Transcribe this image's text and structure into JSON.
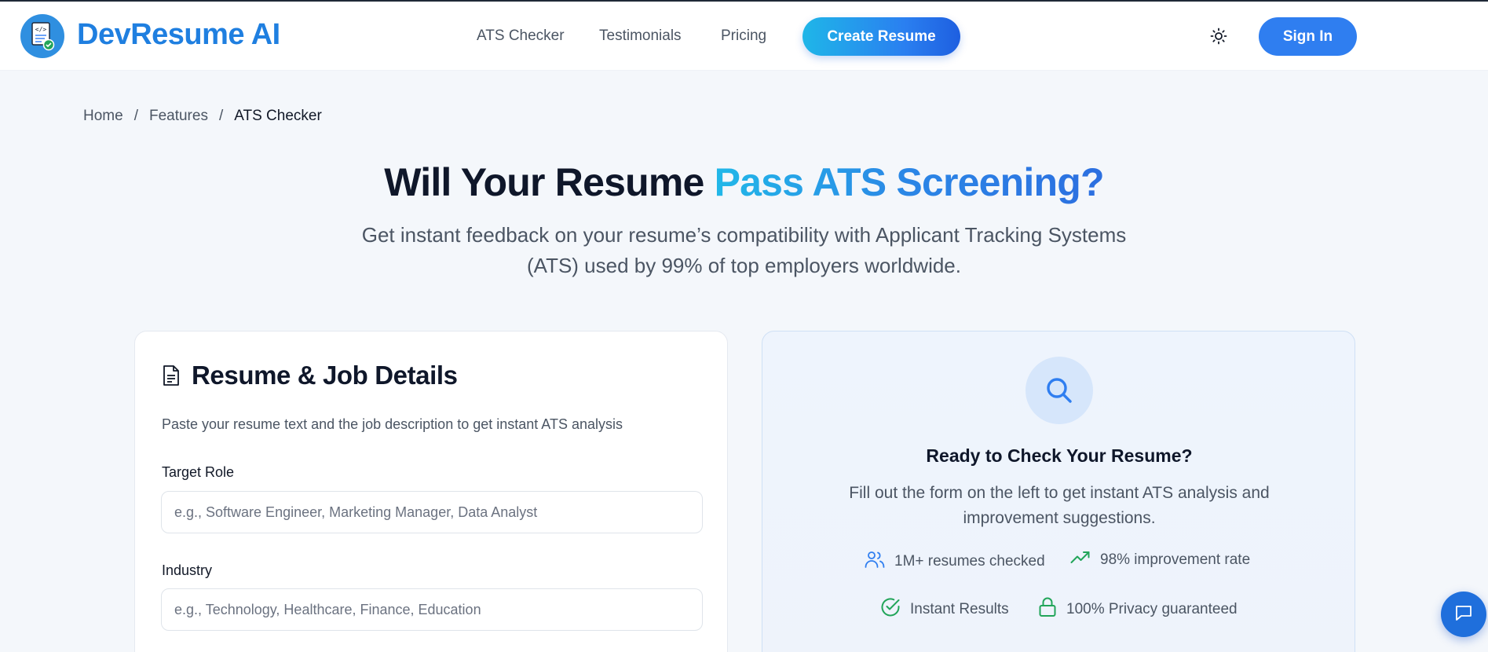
{
  "brand": {
    "name": "DevResume AI",
    "logo_icon": "resume-check-icon"
  },
  "nav": {
    "links": [
      "ATS Checker",
      "Testimonials",
      "Pricing"
    ],
    "create_label": "Create Resume",
    "theme_icon": "sun-icon",
    "signin_label": "Sign In"
  },
  "breadcrumb": {
    "items": [
      "Home",
      "Features",
      "ATS Checker"
    ],
    "separator": "/"
  },
  "hero": {
    "title_plain": "Will Your Resume",
    "title_accent": "Pass ATS Screening?",
    "subtitle": "Get instant feedback on your resume’s compatibility with Applicant Tracking Systems (ATS) used by 99% of top employers worldwide."
  },
  "form_card": {
    "icon": "document-icon",
    "title": "Resume & Job Details",
    "description": "Paste your resume text and the job description to get instant ATS analysis",
    "fields": [
      {
        "label": "Target Role",
        "value": "",
        "placeholder": "e.g., Software Engineer, Marketing Manager, Data Analyst"
      },
      {
        "label": "Industry",
        "value": "",
        "placeholder": "e.g., Technology, Healthcare, Finance, Education"
      }
    ]
  },
  "result_card": {
    "icon": "search-icon",
    "title": "Ready to Check Your Resume?",
    "description": "Fill out the form on the left to get instant ATS analysis and improvement suggestions.",
    "stats": [
      {
        "icon": "users-icon",
        "text": "1M+ resumes checked"
      },
      {
        "icon": "trending-up-icon",
        "text": "98% improvement rate"
      },
      {
        "icon": "check-circle-icon",
        "text": "Instant Results"
      },
      {
        "icon": "lock-icon",
        "text": "100% Privacy guaranteed"
      }
    ]
  },
  "chat": {
    "icon": "chat-icon"
  },
  "colors": {
    "brand": "#1f7fe0",
    "accent_start": "#22b8e8",
    "accent_end": "#2c6fe0",
    "success": "#22a55a"
  }
}
